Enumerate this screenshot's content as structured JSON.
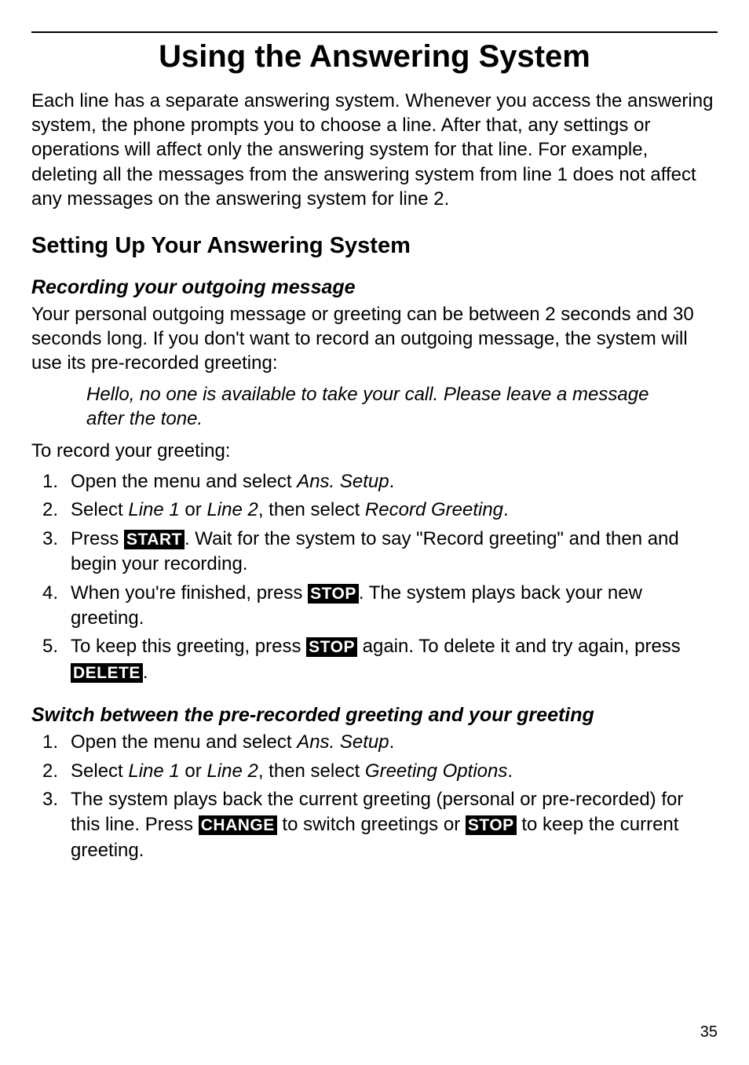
{
  "title": "Using the Answering System",
  "intro": "Each line has a separate answering system. Whenever you access the answering system, the phone prompts you to choose a line. After that, any settings or operations will affect only the answering system for that line. For example, deleting all the messages from the answering system from line 1 does not affect any messages on the answering system for line 2.",
  "section1": {
    "heading": "Setting Up Your Answering System",
    "sub1": {
      "heading": "Recording your outgoing message",
      "para": "Your personal outgoing message or greeting can be between 2 seconds and 30 seconds long. If you don't want to record an outgoing message, the system will use its pre-recorded greeting:",
      "quote": "Hello, no one is available to take your call. Please leave a message after the tone.",
      "lead": "To record your greeting:",
      "steps": {
        "s1a": "Open the menu and select ",
        "s1b": "Ans. Setup",
        "s1c": ".",
        "s2a": "Select ",
        "s2b": "Line 1",
        "s2c": " or ",
        "s2d": "Line 2",
        "s2e": ", then select ",
        "s2f": "Record Greeting",
        "s2g": ".",
        "s3a": "Press ",
        "s3b": "START",
        "s3c": ". Wait for the system to say \"Record greeting\" and then and begin your recording.",
        "s4a": "When you're finished, press ",
        "s4b": "STOP",
        "s4c": ". The system plays back your new greeting.",
        "s5a": "To keep this greeting, press ",
        "s5b": "STOP",
        "s5c": " again. To delete it and try again, press ",
        "s5d": "DELETE",
        "s5e": "."
      }
    },
    "sub2": {
      "heading": "Switch between the pre-recorded greeting and your greeting",
      "steps": {
        "s1a": "Open the menu and select ",
        "s1b": "Ans. Setup",
        "s1c": ".",
        "s2a": "Select ",
        "s2b": "Line 1",
        "s2c": " or ",
        "s2d": "Line 2",
        "s2e": ", then select ",
        "s2f": "Greeting Options",
        "s2g": ".",
        "s3a": "The system plays back the current greeting (personal or pre-recorded) for this line. Press ",
        "s3b": "CHANGE",
        "s3c": " to switch greetings or ",
        "s3d": "STOP",
        "s3e": " to keep the current greeting."
      }
    }
  },
  "pageNumber": "35"
}
